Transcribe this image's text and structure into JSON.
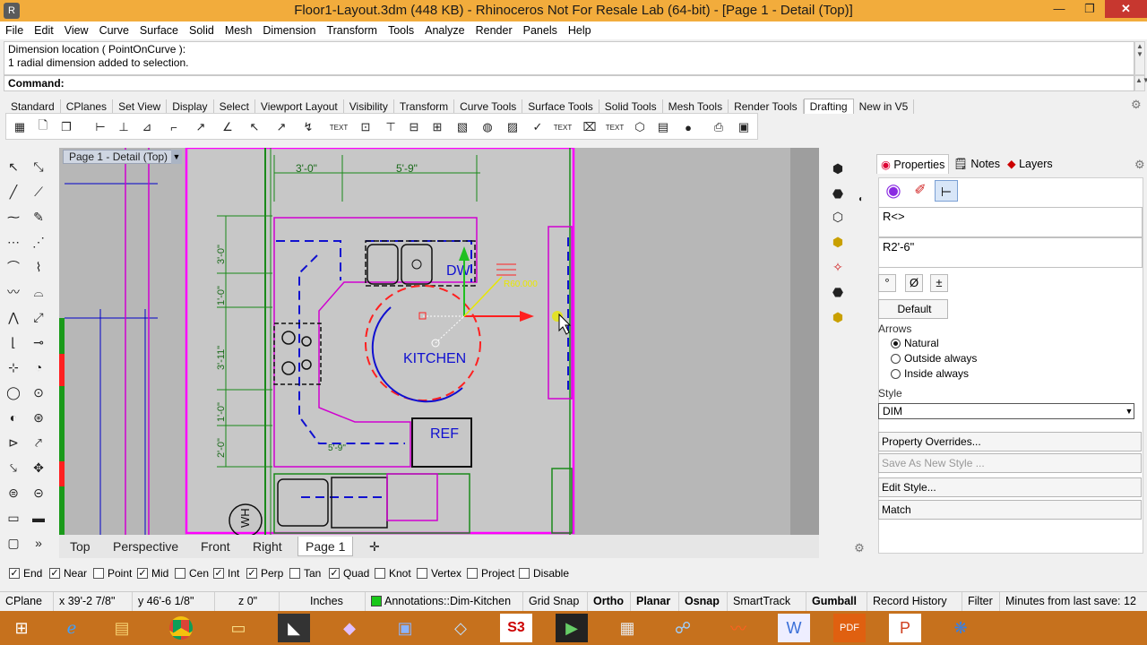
{
  "window": {
    "title": "Floor1-Layout.3dm (448 KB) - Rhinoceros Not For Resale Lab (64-bit) - [Page 1 - Detail (Top)]"
  },
  "menu": [
    "File",
    "Edit",
    "View",
    "Curve",
    "Surface",
    "Solid",
    "Mesh",
    "Dimension",
    "Transform",
    "Tools",
    "Analyze",
    "Render",
    "Panels",
    "Help"
  ],
  "command_history": [
    "Dimension location ( PointOnCurve ):",
    "1 radial dimension added to selection."
  ],
  "command_prompt": "Command:",
  "toolbar_tabs": [
    "Standard",
    "CPlanes",
    "Set View",
    "Display",
    "Select",
    "Viewport Layout",
    "Visibility",
    "Transform",
    "Curve Tools",
    "Surface Tools",
    "Solid Tools",
    "Mesh Tools",
    "Render Tools",
    "Drafting",
    "New in V5"
  ],
  "active_toolbar_tab": "Drafting",
  "viewport": {
    "title": "Page 1 - Detail (Top)",
    "dims": [
      "3'-0\"",
      "5'-9\"",
      "3'-0\"",
      "1'-0\"",
      "3'-11\"",
      "1'-0\"",
      "2'-0\"",
      "5'-9\""
    ],
    "labels": {
      "kitchen": "KITCHEN",
      "dw": "DW",
      "ref": "REF",
      "wh": "WH",
      "radius": "R60.000"
    }
  },
  "view_tabs": [
    "Top",
    "Perspective",
    "Front",
    "Right",
    "Page 1"
  ],
  "active_view_tab": "Page 1",
  "panel": {
    "tabs": [
      "Properties",
      "Notes",
      "Layers"
    ],
    "text_field": "R<>",
    "preview_field": "R2'-6\"",
    "symbol_buttons": [
      "°",
      "Ø",
      "±"
    ],
    "default_button": "Default",
    "arrows_label": "Arrows",
    "arrows_options": [
      "Natural",
      "Outside always",
      "Inside always"
    ],
    "arrows_selected": "Natural",
    "style_label": "Style",
    "style_value": "DIM",
    "buttons": [
      "Property Overrides...",
      "Save As New Style ...",
      "Edit Style...",
      "Match"
    ]
  },
  "osnaps": [
    {
      "label": "End",
      "checked": true
    },
    {
      "label": "Near",
      "checked": true
    },
    {
      "label": "Point",
      "checked": false
    },
    {
      "label": "Mid",
      "checked": true
    },
    {
      "label": "Cen",
      "checked": false
    },
    {
      "label": "Int",
      "checked": true
    },
    {
      "label": "Perp",
      "checked": true
    },
    {
      "label": "Tan",
      "checked": false
    },
    {
      "label": "Quad",
      "checked": true
    },
    {
      "label": "Knot",
      "checked": false
    },
    {
      "label": "Vertex",
      "checked": false
    },
    {
      "label": "Project",
      "checked": false
    },
    {
      "label": "Disable",
      "checked": false
    }
  ],
  "status": {
    "cplane": "CPlane",
    "x": "x 39'-2 7/8\"",
    "y": "y 46'-6 1/8\"",
    "z": "z 0\"",
    "units": "Inches",
    "layer": "Annotations::Dim-Kitchen",
    "layer_color": "#19c819",
    "toggles": [
      "Grid Snap",
      "Ortho",
      "Planar",
      "Osnap",
      "SmartTrack",
      "Gumball",
      "Record History",
      "Filter"
    ],
    "minutes": "Minutes from last save: 12"
  },
  "taskbar_icons": [
    "windows-start",
    "internet-explorer",
    "file-explorer",
    "chrome",
    "folder",
    "rhino",
    "app-4",
    "video",
    "notepad",
    "s3",
    "terminal",
    "image",
    "network",
    "audio",
    "word",
    "pdf",
    "powerpoint",
    "snowflake"
  ]
}
